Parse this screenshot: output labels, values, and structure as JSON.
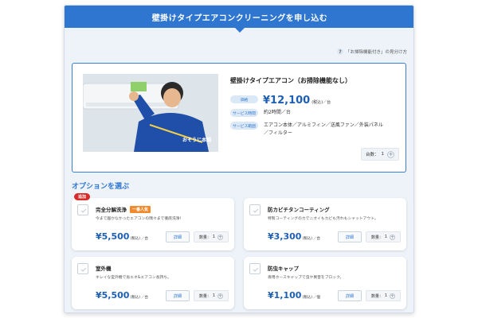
{
  "header": {
    "title": "壁掛けタイプエアコンクリーニングを申し込む"
  },
  "help": {
    "icon": "question-icon",
    "icon_glyph": "?",
    "label": "「お掃除機能付き」の見分け方"
  },
  "main_card": {
    "title": "壁掛けタイプエアコン（お掃除機能なし）",
    "rows": [
      {
        "label": "価格",
        "value": "¥12,100",
        "unit": "(税込)／台"
      },
      {
        "label": "サービス時間",
        "value": "約2時間／台"
      },
      {
        "label": "サービス範囲",
        "value": "エアコン本体／アルミフィン／送風ファン／外装パネル／フィルター"
      }
    ],
    "quantity": {
      "label": "台数：",
      "value": "1",
      "plus": "+"
    },
    "photo_text": "おそうじ本舗"
  },
  "options": {
    "title": "オプションを選ぶ",
    "badge": "追加",
    "detail_label": "詳細",
    "qty_label": "数量：",
    "plus": "+",
    "items": [
      {
        "name": "完全分解洗浄",
        "tag": "一番人気",
        "desc": "今まで届かなかったエアコンの隅々まで徹底洗浄！",
        "price": "¥5,500",
        "tax": "(税込)",
        "per": "／台",
        "qty": "1"
      },
      {
        "name": "防カビチタンコーティング",
        "desc": "特製コーティングのカでニオイもカビも汚れもシャットアウト。",
        "price": "¥3,300",
        "tax": "(税込)",
        "per": "／台",
        "qty": "1"
      },
      {
        "name": "室外機",
        "desc": "キレイな室外機で省エネ&エアコン長持ち。",
        "price": "¥5,500",
        "tax": "(税込)",
        "per": "／台",
        "qty": "1"
      },
      {
        "name": "防虫キャップ",
        "desc": "専用ホースキャップで虫や異音をブロック。",
        "price": "¥1,100",
        "tax": "(税込)",
        "per": "／個",
        "qty": "1"
      }
    ]
  },
  "colors": {
    "accent": "#2e76cf",
    "price": "#1d5fb5",
    "badge": "#d62b2b",
    "tag": "#f08a2c"
  }
}
